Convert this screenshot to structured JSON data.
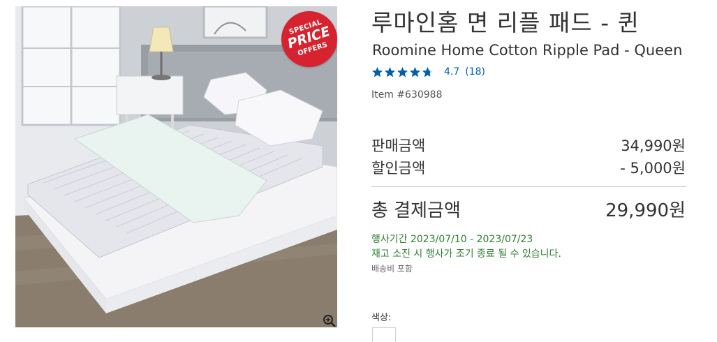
{
  "product": {
    "title_ko": "루마인홈 면 리플 패드 - 퀸",
    "title_en": "Roomine Home Cotton Ripple Pad - Queen",
    "rating": {
      "value": "4.7",
      "count": "(18)",
      "stars_filled": 4.7,
      "stars_total": 5,
      "star_color": "#0060a9"
    },
    "item_number": "Item #630988"
  },
  "badge": {
    "line1": "SPECIAL",
    "line2": "PRICE",
    "line3": "OFFERS",
    "color": "#d6232f"
  },
  "icons": {
    "zoom": "zoom-in-icon",
    "star": "star-icon"
  },
  "pricing": {
    "sale_label": "판매금액",
    "sale_value": "34,990원",
    "discount_label": "할인금액",
    "discount_value": "- 5,000원",
    "total_label": "총 결제금액",
    "total_value": "29,990원"
  },
  "promo": {
    "period": "행사기간 2023/07/10 - 2023/07/23",
    "note": "재고 소진 시 행사가 조기 종료 될 수 있습니다.",
    "shipping": "배송비 포함",
    "color": "#2e7d32"
  },
  "options": {
    "color_label": "색상:"
  }
}
